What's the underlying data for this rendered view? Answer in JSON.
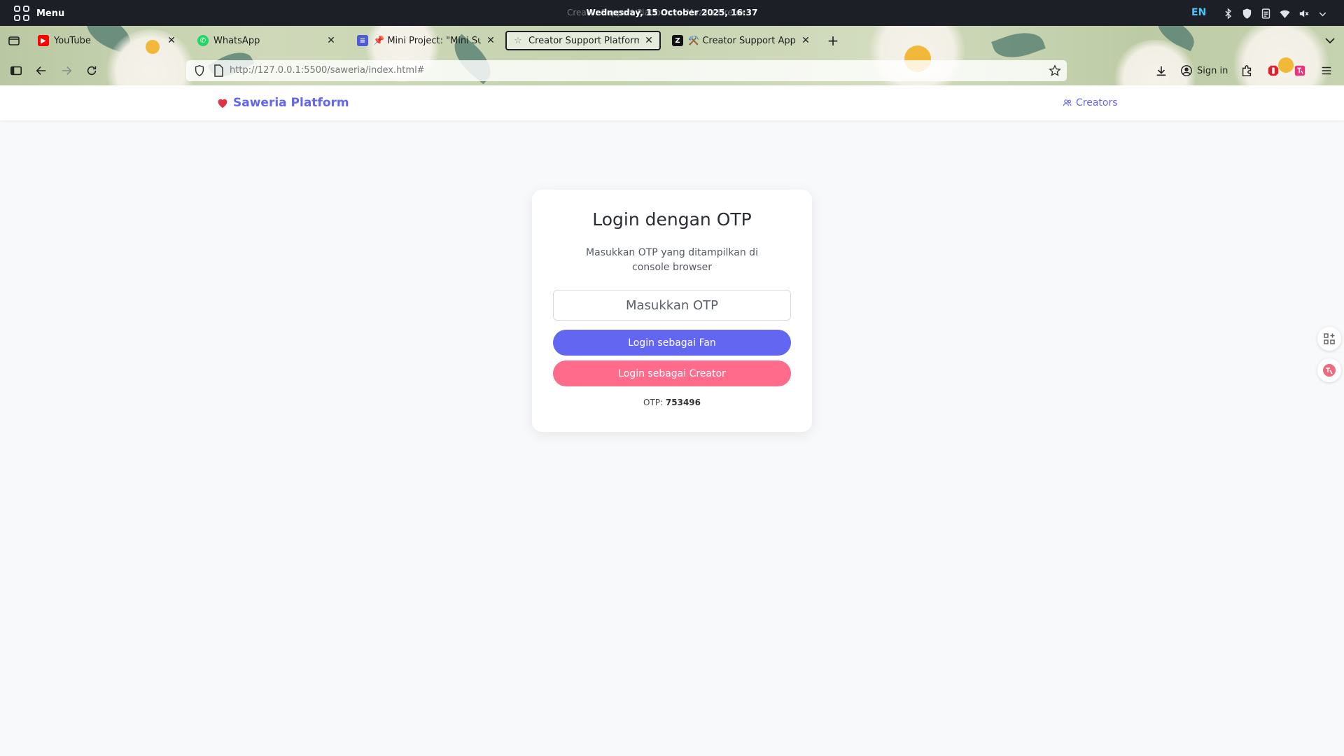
{
  "os": {
    "menu_label": "Menu",
    "window_title": "Creator Support Platform — Mozilla Firefox",
    "clock": "Wednesday, 15 October 2025, 16:37",
    "language": "EN"
  },
  "browser": {
    "tabs": [
      {
        "title": "YouTube",
        "icon": "youtube-icon"
      },
      {
        "title": "WhatsApp",
        "icon": "whatsapp-icon"
      },
      {
        "title": "📌 Mini Project: \"Mini Support",
        "icon": "docs-icon"
      },
      {
        "title": "Creator Support Platform - Mozilla",
        "icon": "star-icon",
        "active": true
      },
      {
        "title": "⚒️ Creator Support App | Z.ai",
        "icon": "zai-icon"
      }
    ],
    "url": "http://127.0.0.1:5500/saweria/index.html#",
    "sign_in_label": "Sign in"
  },
  "site": {
    "brand": "Saweria Platform",
    "nav_creators": "Creators",
    "accent_color": "#6366f1"
  },
  "login": {
    "title": "Login dengan OTP",
    "description": "Masukkan OTP yang ditampilkan di console browser",
    "otp_placeholder": "Masukkan OTP",
    "fan_button": "Login sebagai Fan",
    "creator_button": "Login sebagai Creator",
    "otp_label": "OTP:",
    "otp_value": "753496",
    "fan_color": "#6366f1",
    "creator_color": "#ff6b8b"
  }
}
